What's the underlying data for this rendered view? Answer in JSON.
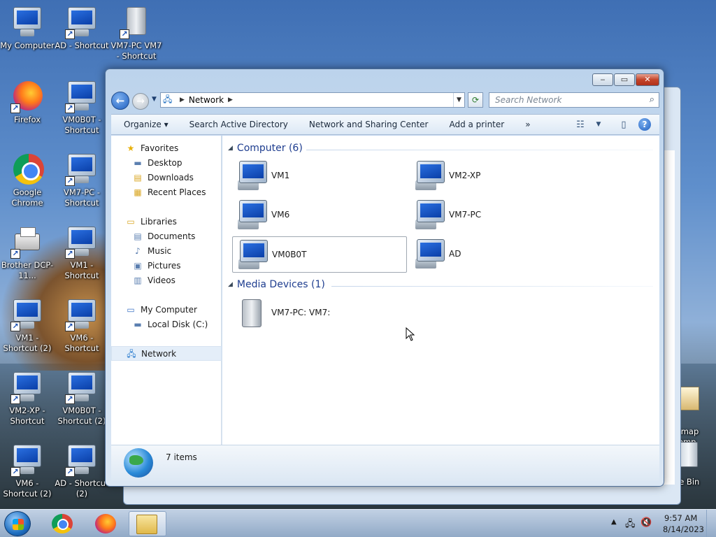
{
  "desktop": {
    "icons": [
      {
        "label": "My Computer",
        "kind": "computer"
      },
      {
        "label": "AD - Shortcut",
        "kind": "computer-shortcut"
      },
      {
        "label": "VM7-PC VM7 - Shortcut",
        "kind": "media-shortcut"
      },
      {
        "label": "Firefox",
        "kind": "firefox"
      },
      {
        "label": "VM0B0T - Shortcut",
        "kind": "computer-shortcut"
      },
      {
        "label": "Google Chrome",
        "kind": "chrome"
      },
      {
        "label": "VM7-PC - Shortcut",
        "kind": "computer-shortcut"
      },
      {
        "label": "Brother DCP-11...",
        "kind": "printer"
      },
      {
        "label": "VM1 - Shortcut",
        "kind": "computer-shortcut"
      },
      {
        "label": "VM1 - Shortcut (2)",
        "kind": "computer-shortcut"
      },
      {
        "label": "VM6 - Shortcut",
        "kind": "computer-shortcut"
      },
      {
        "label": "VM2-XP - Shortcut",
        "kind": "computer-shortcut"
      },
      {
        "label": "VM0B0T - Shortcut (2)",
        "kind": "computer-shortcut"
      },
      {
        "label": "VM6 - Shortcut (2)",
        "kind": "computer-shortcut"
      },
      {
        "label": "AD - Shortcut (2)",
        "kind": "computer-shortcut"
      }
    ],
    "partial_labels": {
      "bitmap": "itmap\n.bmp",
      "recycle": "le Bin"
    }
  },
  "window": {
    "caption": {
      "minimize": "‒",
      "maximize": "▭",
      "close": "✕"
    },
    "address": {
      "root_icon": "network-icon",
      "path": "Network"
    },
    "search": {
      "placeholder": "Search Network"
    },
    "toolbar": {
      "organize": "Organize",
      "search_ad": "Search Active Directory",
      "sharing_center": "Network and Sharing Center",
      "add_printer": "Add a printer",
      "more": "»",
      "help": "?"
    },
    "nav": {
      "favorites": {
        "label": "Favorites",
        "items": [
          "Desktop",
          "Downloads",
          "Recent Places"
        ]
      },
      "libraries": {
        "label": "Libraries",
        "items": [
          "Documents",
          "Music",
          "Pictures",
          "Videos"
        ]
      },
      "computer": {
        "label": "My Computer",
        "items": [
          "Local Disk (C:)"
        ]
      },
      "network": {
        "label": "Network"
      }
    },
    "content": {
      "computer_group": {
        "header": "Computer (6)",
        "items": [
          "VM1",
          "VM2-XP",
          "VM6",
          "VM7-PC",
          "VM0B0T",
          "AD"
        ]
      },
      "media_group": {
        "header": "Media Devices (1)",
        "items": [
          "VM7-PC: VM7:"
        ]
      }
    },
    "details": {
      "count": "7 items"
    }
  },
  "taskbar": {
    "clock": {
      "time": "9:57 AM",
      "date": "8/14/2023"
    }
  }
}
